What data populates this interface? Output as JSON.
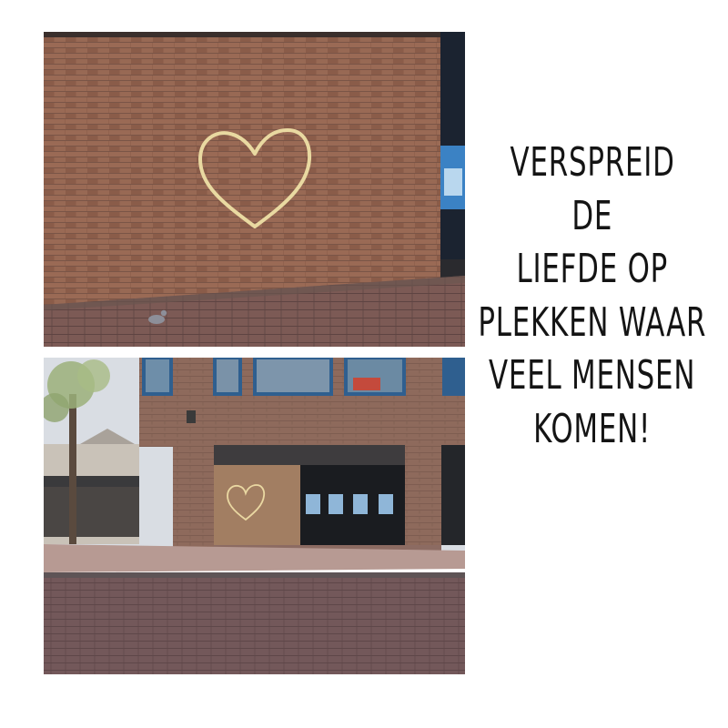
{
  "caption": {
    "lines": [
      "VERSPREID",
      "DE",
      "LIEFDE OP",
      "PLEKKEN WAAR",
      "VEEL MENSEN",
      "KOMEN!"
    ]
  },
  "photos": [
    {
      "subject": "heart-drawn-on-brick-wall"
    },
    {
      "subject": "bank-building-street-view"
    }
  ],
  "colors": {
    "brick": "#8f6450",
    "heart_chalk": "#e8d7a0",
    "pavement": "#7a5f5c",
    "text": "#141414"
  }
}
